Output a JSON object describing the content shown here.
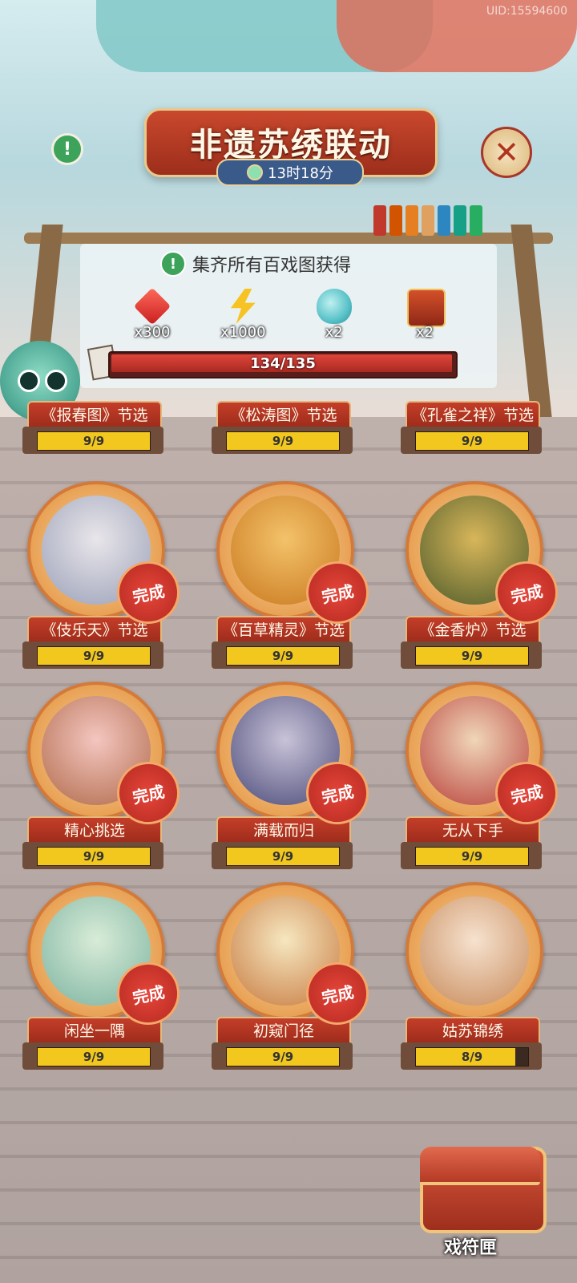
{
  "uid": "UID:15594600",
  "header": {
    "title": "非遗苏绣联动",
    "timer": "13时18分"
  },
  "rewards_panel": {
    "condition": "集齐所有百戏图获得",
    "items": [
      {
        "icon": "red-gem-icon",
        "qty": "x300"
      },
      {
        "icon": "lightning-icon",
        "qty": "x1000"
      },
      {
        "icon": "gourd-icon",
        "qty": "x2"
      },
      {
        "icon": "mystery-chest-icon",
        "qty": "x2"
      }
    ],
    "progress_text": "134/135",
    "progress_fraction": 0.9926
  },
  "cards": [
    {
      "title": "《报春图》节选",
      "progress": "9/9",
      "fraction": 1.0,
      "done": "",
      "partial": true
    },
    {
      "title": "《松涛图》节选",
      "progress": "9/9",
      "fraction": 1.0,
      "done": "",
      "partial": true
    },
    {
      "title": "《孔雀之祥》节选",
      "progress": "9/9",
      "fraction": 1.0,
      "done": "",
      "partial": true
    },
    {
      "title": "《伎乐天》节选",
      "progress": "9/9",
      "fraction": 1.0,
      "done": "完成",
      "art": [
        "#e9e6ea",
        "#9aa0b8"
      ]
    },
    {
      "title": "《百草精灵》节选",
      "progress": "9/9",
      "fraction": 1.0,
      "done": "完成",
      "art": [
        "#f3c26a",
        "#c9781e"
      ]
    },
    {
      "title": "《金香炉》节选",
      "progress": "9/9",
      "fraction": 1.0,
      "done": "完成",
      "art": [
        "#d8b65a",
        "#4c5a2a"
      ]
    },
    {
      "title": "精心挑选",
      "progress": "9/9",
      "fraction": 1.0,
      "done": "完成",
      "art": [
        "#f4c6c0",
        "#b06a4a"
      ]
    },
    {
      "title": "满载而归",
      "progress": "9/9",
      "fraction": 1.0,
      "done": "完成",
      "art": [
        "#c9c3d8",
        "#4a4a78"
      ]
    },
    {
      "title": "无从下手",
      "progress": "9/9",
      "fraction": 1.0,
      "done": "完成",
      "art": [
        "#f0d6b8",
        "#b8403a"
      ]
    },
    {
      "title": "闲坐一隅",
      "progress": "9/9",
      "fraction": 1.0,
      "done": "完成",
      "art": [
        "#d8ecd8",
        "#7cb3a0"
      ]
    },
    {
      "title": "初窥门径",
      "progress": "9/9",
      "fraction": 1.0,
      "done": "完成",
      "art": [
        "#f6e7c0",
        "#c77a40"
      ]
    },
    {
      "title": "姑苏锦绣",
      "progress": "8/9",
      "fraction": 0.8889,
      "done": "",
      "art": [
        "#f6e2cf",
        "#c78a5a"
      ]
    }
  ],
  "bottom": {
    "chest_label": "戏符匣"
  },
  "colors": {
    "accent_red": "#c33e29",
    "bar_yellow": "#f2c81e",
    "timer_blue": "#3a5a8a"
  }
}
